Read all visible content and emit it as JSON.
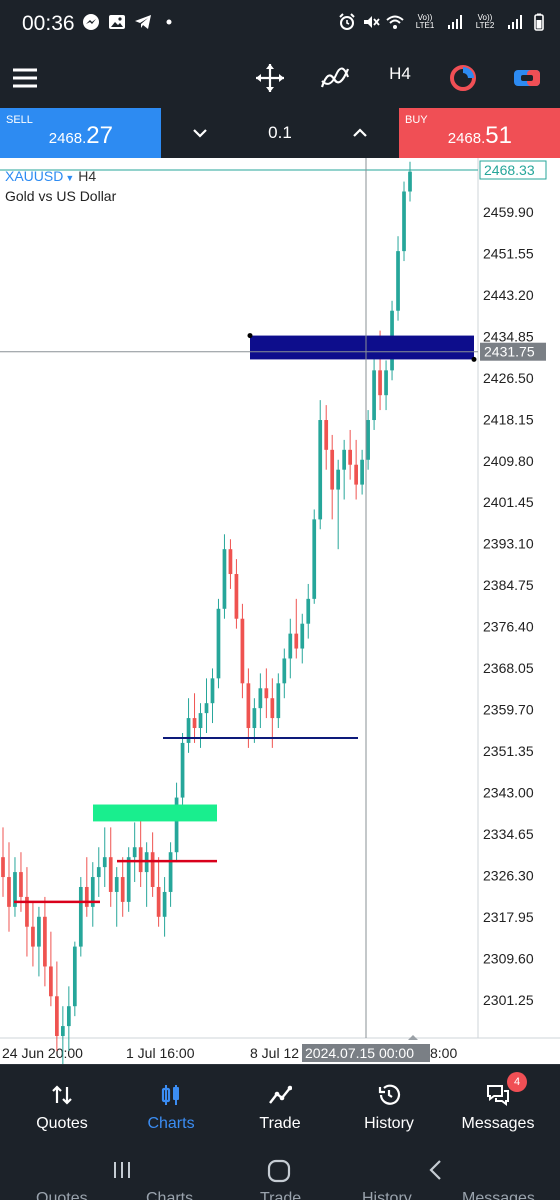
{
  "status_bar": {
    "time": "00:36",
    "sim1": "Vo)) LTE1",
    "sim2": "Vo)) LTE2",
    "wifi_badge": "6"
  },
  "toolbar": {
    "menu_icon": "hamburger-icon",
    "crosshair_icon": "move-crosshair-icon",
    "indicators_icon": "indicators-icon",
    "timeframe": "H4",
    "objects_icon": "objects-icon",
    "trade_icon": "one-click-trade-icon"
  },
  "trade_bar": {
    "sell_label": "SELL",
    "sell_price_main": "2468.",
    "sell_price_big": "27",
    "volume": "0.1",
    "buy_label": "BUY",
    "buy_price_main": "2468.",
    "buy_price_big": "51"
  },
  "chart": {
    "symbol": "XAUUSD",
    "timeframe": "H4",
    "description": "Gold vs US Dollar",
    "price_labels": [
      "2468.33",
      "2459.90",
      "2451.55",
      "2443.20",
      "2434.85",
      "2426.50",
      "2418.15",
      "2409.80",
      "2401.45",
      "2393.10",
      "2384.75",
      "2376.40",
      "2368.05",
      "2359.70",
      "2351.35",
      "2343.00",
      "2334.65",
      "2326.30",
      "2317.95",
      "2309.60",
      "2301.25"
    ],
    "current_price": "2468.33",
    "crosshair_price": "2431.75",
    "time_labels": [
      "24 Jun 20:00",
      "1 Jul 16:00",
      "8 Jul 12",
      "8:00"
    ],
    "crosshair_time": "2024.07.15 00:00",
    "colors": {
      "bull": "#26a69a",
      "bear": "#ef5350",
      "zone_blue": "#0d0d8c",
      "zone_green": "#19ee8e",
      "line_red": "#d9001b",
      "line_navy": "#0d1a7a",
      "price_line": "#26a69a"
    },
    "candles": [
      [
        2330,
        2336,
        2322,
        2326
      ],
      [
        2326,
        2333,
        2315,
        2320
      ],
      [
        2320,
        2330,
        2318,
        2327
      ],
      [
        2327,
        2331,
        2319,
        2322
      ],
      [
        2322,
        2328,
        2310,
        2316
      ],
      [
        2316,
        2321,
        2308,
        2312
      ],
      [
        2312,
        2320,
        2306,
        2318
      ],
      [
        2318,
        2322,
        2304,
        2308
      ],
      [
        2308,
        2315,
        2300,
        2302
      ],
      [
        2302,
        2309,
        2291,
        2294
      ],
      [
        2294,
        2300,
        2288,
        2296
      ],
      [
        2296,
        2304,
        2291,
        2300
      ],
      [
        2300,
        2313,
        2298,
        2312
      ],
      [
        2312,
        2326,
        2310,
        2324
      ],
      [
        2324,
        2330,
        2318,
        2320
      ],
      [
        2320,
        2329,
        2316,
        2326
      ],
      [
        2326,
        2332,
        2322,
        2328
      ],
      [
        2328,
        2336,
        2324,
        2330
      ],
      [
        2330,
        2336,
        2320,
        2323
      ],
      [
        2323,
        2328,
        2316,
        2326
      ],
      [
        2326,
        2330,
        2318,
        2321
      ],
      [
        2321,
        2332,
        2319,
        2330
      ],
      [
        2330,
        2337,
        2325,
        2332
      ],
      [
        2332,
        2338,
        2324,
        2327
      ],
      [
        2327,
        2333,
        2320,
        2331
      ],
      [
        2331,
        2335,
        2322,
        2324
      ],
      [
        2324,
        2330,
        2316,
        2318
      ],
      [
        2318,
        2326,
        2314,
        2323
      ],
      [
        2323,
        2333,
        2320,
        2331
      ],
      [
        2331,
        2345,
        2329,
        2342
      ],
      [
        2342,
        2355,
        2340,
        2353
      ],
      [
        2353,
        2362,
        2351,
        2358
      ],
      [
        2358,
        2363,
        2353,
        2356
      ],
      [
        2356,
        2361,
        2352,
        2359
      ],
      [
        2359,
        2366,
        2355,
        2361
      ],
      [
        2361,
        2368,
        2357,
        2366
      ],
      [
        2366,
        2382,
        2364,
        2380
      ],
      [
        2380,
        2395,
        2378,
        2392
      ],
      [
        2392,
        2394,
        2384,
        2387
      ],
      [
        2387,
        2390,
        2376,
        2378
      ],
      [
        2378,
        2381,
        2362,
        2365
      ],
      [
        2365,
        2368,
        2352,
        2356
      ],
      [
        2356,
        2362,
        2353,
        2360
      ],
      [
        2360,
        2367,
        2356,
        2364
      ],
      [
        2364,
        2368,
        2358,
        2362
      ],
      [
        2362,
        2366,
        2352,
        2358
      ],
      [
        2358,
        2367,
        2356,
        2365
      ],
      [
        2365,
        2372,
        2362,
        2370
      ],
      [
        2370,
        2378,
        2366,
        2375
      ],
      [
        2375,
        2382,
        2370,
        2372
      ],
      [
        2372,
        2379,
        2369,
        2377
      ],
      [
        2377,
        2385,
        2374,
        2382
      ],
      [
        2382,
        2400,
        2381,
        2398
      ],
      [
        2398,
        2422,
        2396,
        2418
      ],
      [
        2418,
        2421,
        2408,
        2412
      ],
      [
        2412,
        2415,
        2398,
        2404
      ],
      [
        2404,
        2410,
        2392,
        2408
      ],
      [
        2408,
        2414,
        2402,
        2412
      ],
      [
        2412,
        2416,
        2406,
        2409
      ],
      [
        2409,
        2414,
        2402,
        2405
      ],
      [
        2405,
        2412,
        2403,
        2410
      ],
      [
        2410,
        2420,
        2408,
        2418
      ],
      [
        2418,
        2432,
        2416,
        2428
      ],
      [
        2428,
        2436,
        2420,
        2423
      ],
      [
        2423,
        2430,
        2420,
        2428
      ],
      [
        2428,
        2442,
        2426,
        2440
      ],
      [
        2440,
        2455,
        2438,
        2452
      ],
      [
        2452,
        2466,
        2450,
        2464
      ],
      [
        2464,
        2470,
        2462,
        2468
      ]
    ]
  },
  "bottom_nav": [
    {
      "label": "Quotes",
      "icon": "quotes-icon"
    },
    {
      "label": "Charts",
      "icon": "charts-icon",
      "active": true
    },
    {
      "label": "Trade",
      "icon": "trade-icon"
    },
    {
      "label": "History",
      "icon": "history-icon"
    },
    {
      "label": "Messages",
      "icon": "messages-icon",
      "badge": "4"
    }
  ],
  "system_nav": [
    "recents-icon",
    "home-icon",
    "back-icon"
  ]
}
